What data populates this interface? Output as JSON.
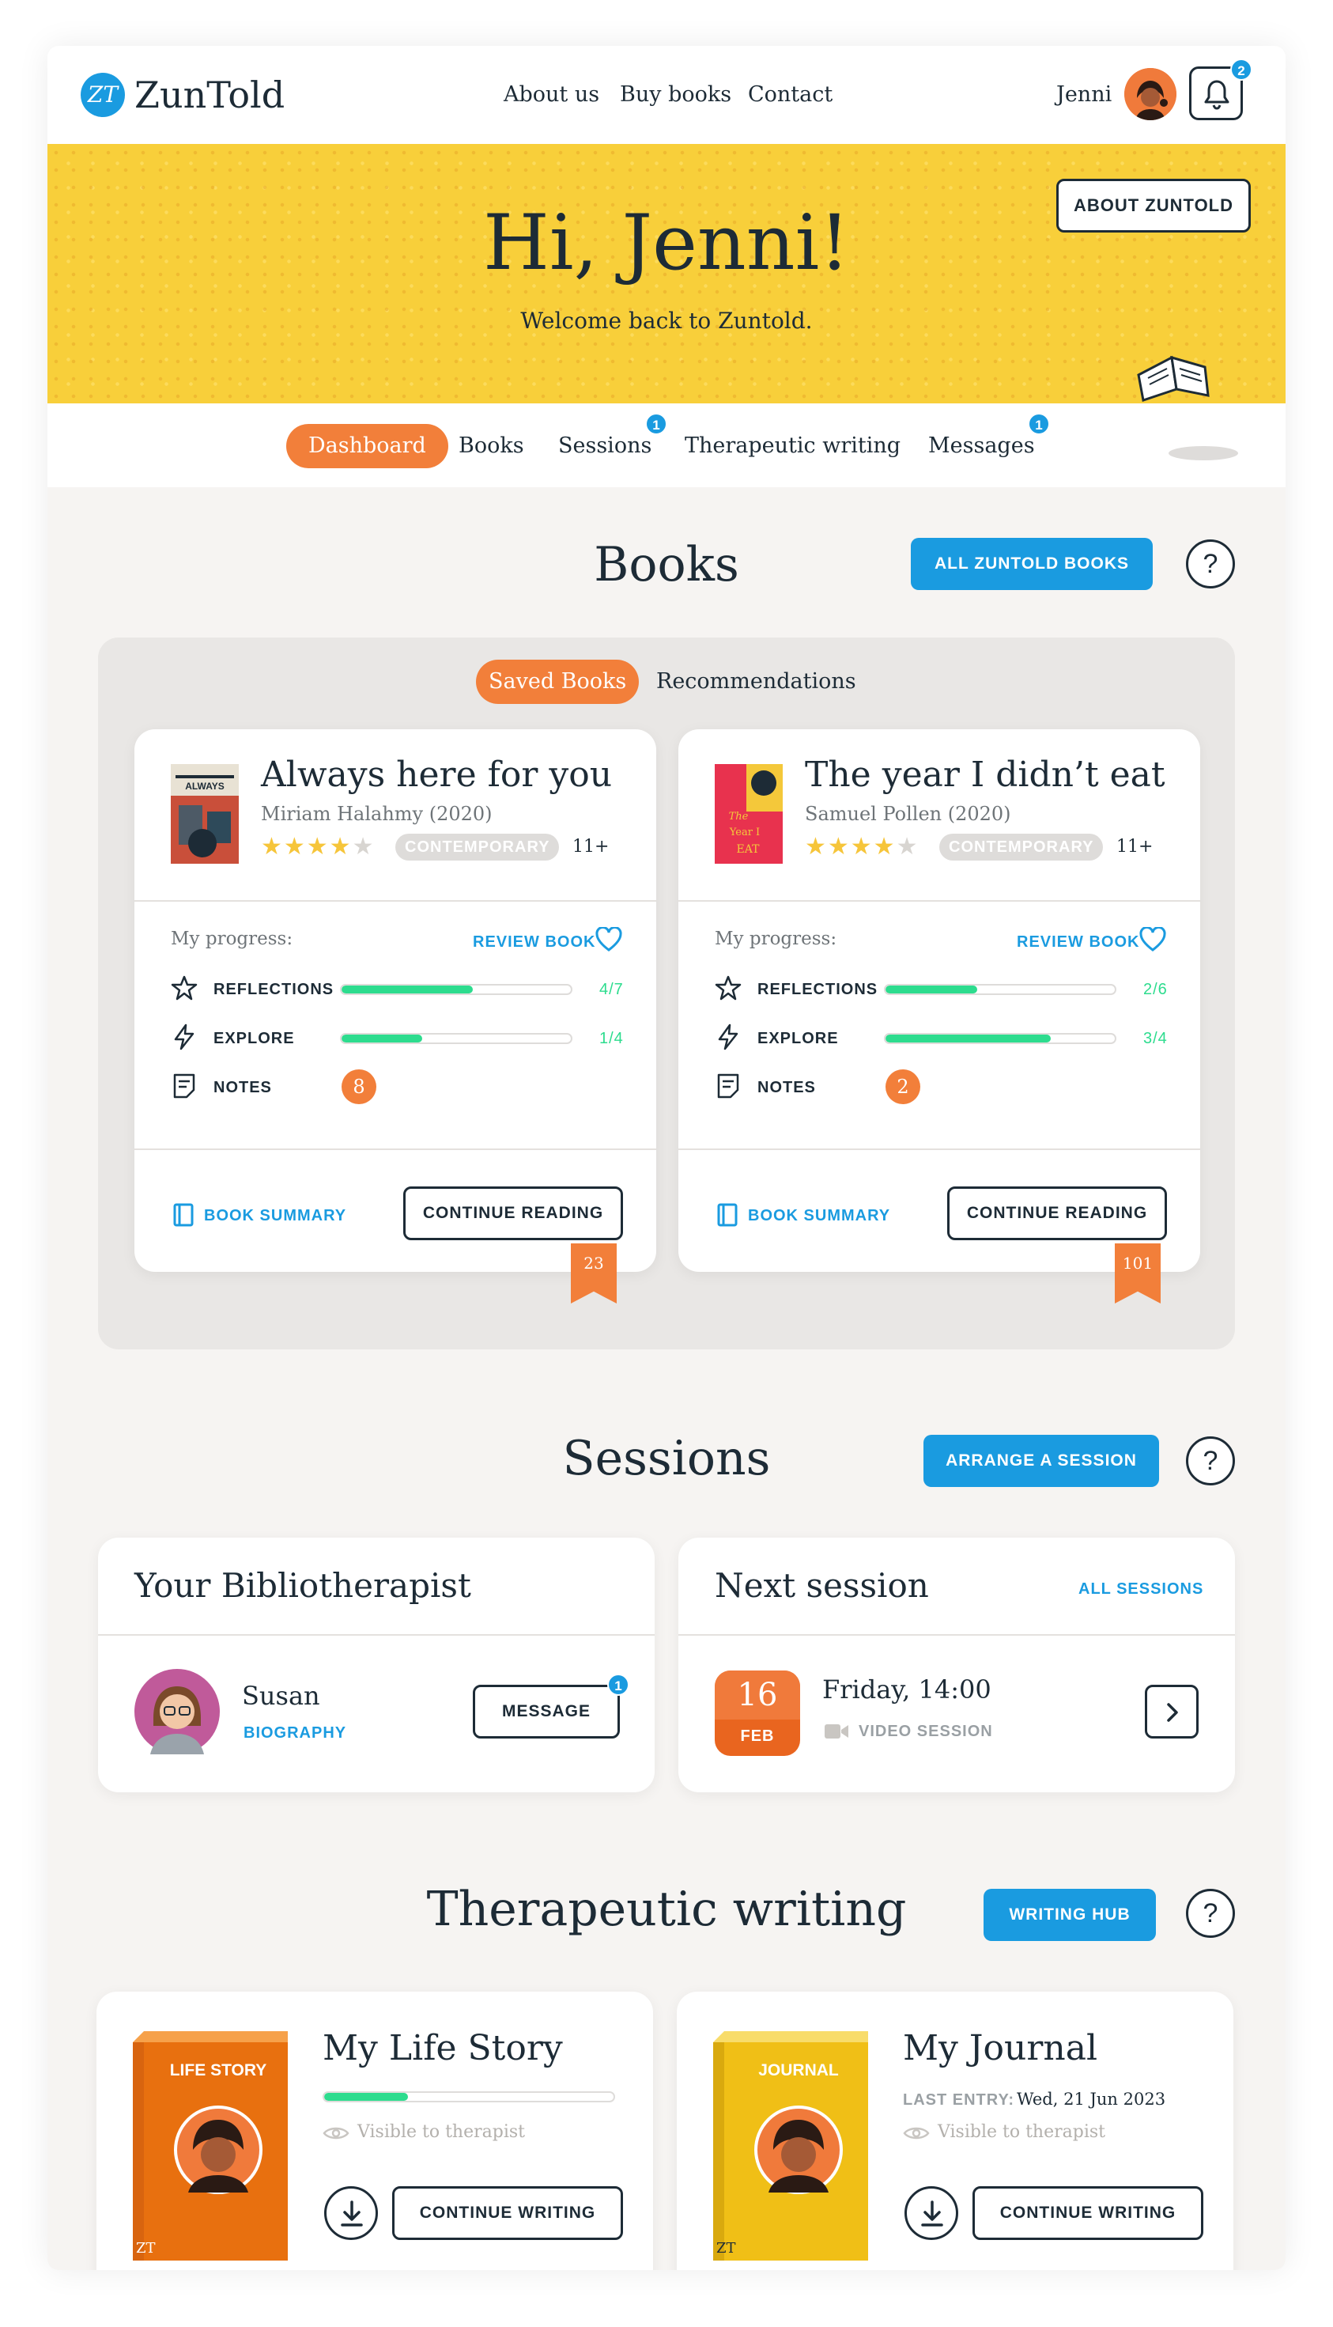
{
  "header": {
    "logo_mark": "ZT",
    "logo_text": "ZunTold",
    "nav": [
      "About us",
      "Buy books",
      "Contact"
    ],
    "username": "Jenni",
    "notifications": "2"
  },
  "hero": {
    "title": "Hi, Jenni!",
    "subtitle": "Welcome back to Zuntold.",
    "about_button": "ABOUT ZUNTOLD"
  },
  "tabs": [
    {
      "label": "Dashboard",
      "badge": ""
    },
    {
      "label": "Books",
      "badge": ""
    },
    {
      "label": "Sessions",
      "badge": "1"
    },
    {
      "label": "Therapeutic writing",
      "badge": ""
    },
    {
      "label": "Messages",
      "badge": "1"
    }
  ],
  "books": {
    "title": "Books",
    "all_button": "ALL ZUNTOLD BOOKS",
    "help": "?",
    "subtabs": [
      "Saved Books",
      "Recommendations"
    ],
    "progress_label": "My progress:",
    "review_label": "REVIEW BOOK",
    "summary_label": "BOOK SUMMARY",
    "continue_label": "CONTINUE READING",
    "row_labels": {
      "reflections": "REFLECTIONS",
      "explore": "EXPLORE",
      "notes": "NOTES"
    },
    "items": [
      {
        "title": "Always here for you",
        "author": "Miriam Halahmy (2020)",
        "cover_text": "ALWAYS",
        "rating": 4.5,
        "genre": "CONTEMPORARY",
        "age": "11+",
        "reflections": {
          "text": "4/7",
          "fraction": 0.571
        },
        "explore": {
          "text": "1/4",
          "fraction": 0.35
        },
        "notes": "8",
        "page": "23"
      },
      {
        "title": "The year I didn’t eat",
        "author": "Samuel Pollen (2020)",
        "cover_text": "The Year I Didn't Eat",
        "rating": 4.5,
        "genre": "CONTEMPORARY",
        "age": "11+",
        "reflections": {
          "text": "2/6",
          "fraction": 0.4
        },
        "explore": {
          "text": "3/4",
          "fraction": 0.72
        },
        "notes": "2",
        "page": "101"
      }
    ]
  },
  "sessions": {
    "title": "Sessions",
    "arrange_button": "ARRANGE A SESSION",
    "help": "?",
    "therapist_card_title": "Your Bibliotherapist",
    "therapist_name": "Susan",
    "biography_link": "BIOGRAPHY",
    "message_button": "MESSAGE",
    "message_badge": "1",
    "next_card_title": "Next session",
    "all_sessions_link": "ALL SESSIONS",
    "date_day": "16",
    "date_month": "FEB",
    "session_time": "Friday, 14:00",
    "session_type": "VIDEO SESSION"
  },
  "writing": {
    "title": "Therapeutic writing",
    "hub_button": "WRITING HUB",
    "help": "?",
    "continue_label": "CONTINUE WRITING",
    "visible_label": "Visible to therapist",
    "items": [
      {
        "title": "My Life Story",
        "cover_label": "LIFE STORY",
        "progress": 0.29,
        "cover_color": "#f07a17"
      },
      {
        "title": "My Journal",
        "cover_label": "JOURNAL",
        "last_entry_label": "LAST ENTRY:",
        "last_entry": "Wed, 21 Jun 2023",
        "cover_color": "#f4c71a"
      }
    ]
  },
  "colors": {
    "accent_orange": "#f27f3a",
    "accent_blue": "#1a9be0",
    "hero_yellow": "#f8cf3a",
    "progress_green": "#2ddc8e",
    "text_dark": "#1d2b36"
  }
}
